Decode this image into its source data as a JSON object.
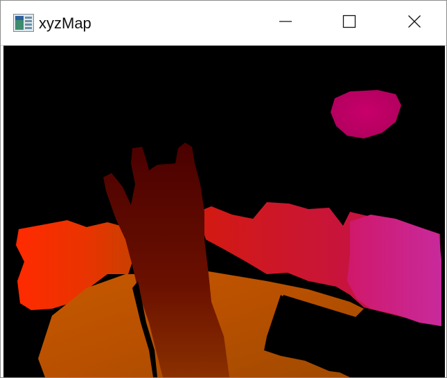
{
  "window": {
    "title": "xyzMap",
    "icon": "app-window-icon"
  },
  "controls": {
    "minimize_icon": "minimize-icon",
    "maximize_icon": "maximize-icon",
    "close_icon": "close-icon"
  },
  "viewport": {
    "content": "depth-map-visualization",
    "background_color": "#000000",
    "palette": [
      "#ff2a00",
      "#e83a00",
      "#ff0030",
      "#d0006a",
      "#ff1fa0",
      "#c41ea8",
      "#5a0000"
    ]
  }
}
